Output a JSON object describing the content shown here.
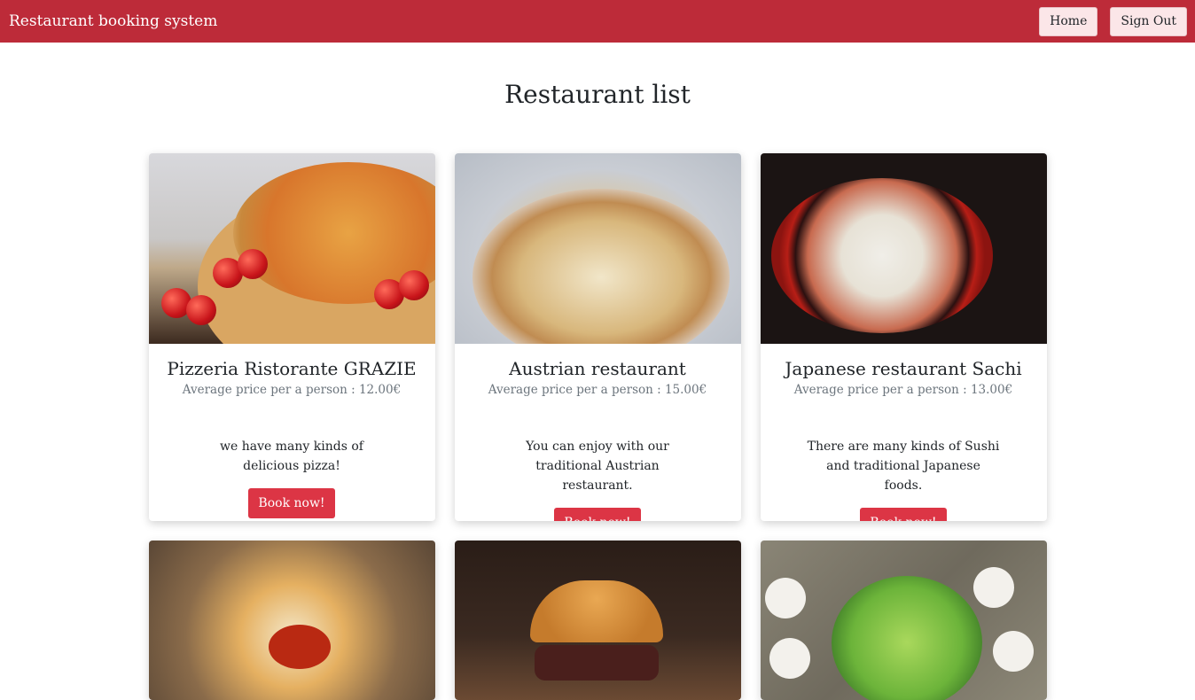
{
  "header": {
    "brand": "Restaurant booking system",
    "home_label": "Home",
    "signout_label": "Sign Out",
    "color": "#bd2b39"
  },
  "page": {
    "title": "Restaurant list"
  },
  "restaurants": [
    {
      "name": "Pizzeria Ristorante GRAZIE",
      "price": "Average price per a person : 12.00€",
      "desc": "we have many kinds of delicious pizza!",
      "button": "Book now!",
      "image": "pizza"
    },
    {
      "name": "Austrian restaurant",
      "price": "Average price per a person : 15.00€",
      "desc": "You can enjoy with our traditional Austrian restaurant.",
      "button": "Book now!",
      "image": "pasta"
    },
    {
      "name": "Japanese restaurant Sachi",
      "price": "Average price per a person : 13.00€",
      "desc": "There are many kinds of Sushi and traditional Japanese foods.",
      "button": "Book now!",
      "image": "sushi"
    },
    {
      "image": "bibimbap"
    },
    {
      "image": "burger"
    },
    {
      "image": "salad"
    }
  ],
  "accent": "#dc3545"
}
